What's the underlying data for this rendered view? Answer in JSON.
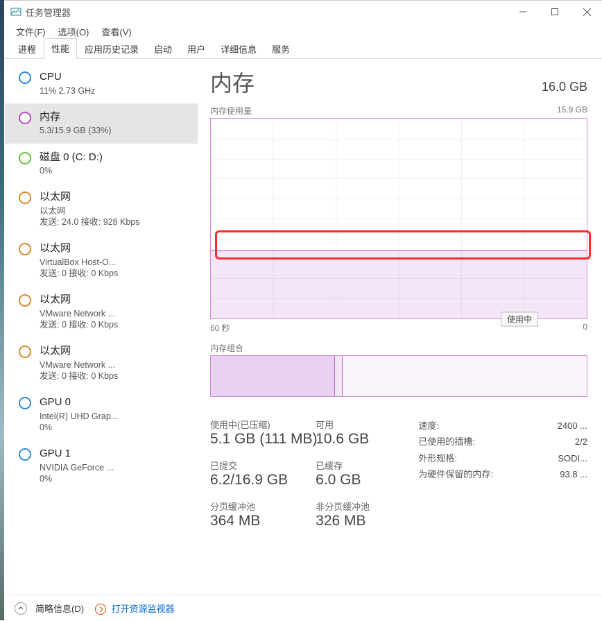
{
  "window": {
    "title": "任务管理器"
  },
  "menu": {
    "file": "文件(F)",
    "options": "选项(O)",
    "view": "查看(V)"
  },
  "tabs": [
    "进程",
    "性能",
    "应用历史记录",
    "启动",
    "用户",
    "详细信息",
    "服务"
  ],
  "active_tab_index": 1,
  "sidebar": {
    "items": [
      {
        "title": "CPU",
        "sub1": "11% 2.73 GHz",
        "ring": "#2c8cd6"
      },
      {
        "title": "内存",
        "sub1": "5.3/15.9 GB (33%)",
        "ring": "#b64cc6",
        "selected": true
      },
      {
        "title": "磁盘 0 (C: D:)",
        "sub1": "0%",
        "ring": "#67c23a"
      },
      {
        "title": "以太网",
        "sub1": "以太网",
        "sub2": "发送: 24.0 接收: 928 Kbps",
        "ring": "#d98a2b"
      },
      {
        "title": "以太网",
        "sub1": "VirtualBox Host-O...",
        "sub2": "发送: 0 接收: 0 Kbps",
        "ring": "#d98a2b"
      },
      {
        "title": "以太网",
        "sub1": "VMware Network ...",
        "sub2": "发送: 0 接收: 0 Kbps",
        "ring": "#d98a2b"
      },
      {
        "title": "以太网",
        "sub1": "VMware Network ...",
        "sub2": "发送: 0 接收: 0 Kbps",
        "ring": "#d98a2b"
      },
      {
        "title": "GPU 0",
        "sub1": "Intel(R) UHD Grap...",
        "sub2": "0%",
        "ring": "#2c8cd6"
      },
      {
        "title": "GPU 1",
        "sub1": "NVIDIA GeForce ...",
        "sub2": "0%",
        "ring": "#2c8cd6"
      }
    ]
  },
  "detail": {
    "title": "内存",
    "total": "16.0 GB",
    "usage_label": "内存使用量",
    "usage_max": "15.9 GB",
    "x_left": "60 秒",
    "x_right": "0",
    "inuse_marker": "使用中",
    "comp_label": "内存组合",
    "stats": {
      "inuse_label": "使用中(已压缩)",
      "inuse_value": "5.1 GB (111 MB)",
      "avail_label": "可用",
      "avail_value": "10.6 GB",
      "committed_label": "已提交",
      "committed_value": "6.2/16.9 GB",
      "cached_label": "已缓存",
      "cached_value": "6.0 GB",
      "paged_label": "分页缓冲池",
      "paged_value": "364 MB",
      "nonpaged_label": "非分页缓冲池",
      "nonpaged_value": "326 MB"
    },
    "meta": {
      "speed_label": "速度:",
      "speed_value": "2400 ...",
      "slots_label": "已使用的插槽:",
      "slots_value": "2/2",
      "form_label": "外形规格:",
      "form_value": "SODI...",
      "reserved_label": "为硬件保留的内存:",
      "reserved_value": "93.8 ..."
    }
  },
  "footer": {
    "fewer": "简略信息(D)",
    "resmon": "打开资源监视器"
  },
  "chart_data": {
    "type": "line",
    "title": "内存使用量",
    "xlabel": "60 秒 → 0",
    "ylabel": "GB",
    "ylim": [
      0,
      15.9
    ],
    "x": [
      60,
      55,
      50,
      45,
      40,
      35,
      30,
      25,
      20,
      15,
      10,
      5,
      0
    ],
    "values": [
      5.3,
      5.3,
      5.3,
      5.3,
      5.3,
      5.3,
      5.3,
      5.3,
      5.3,
      5.3,
      5.2,
      5.1,
      5.1
    ]
  }
}
